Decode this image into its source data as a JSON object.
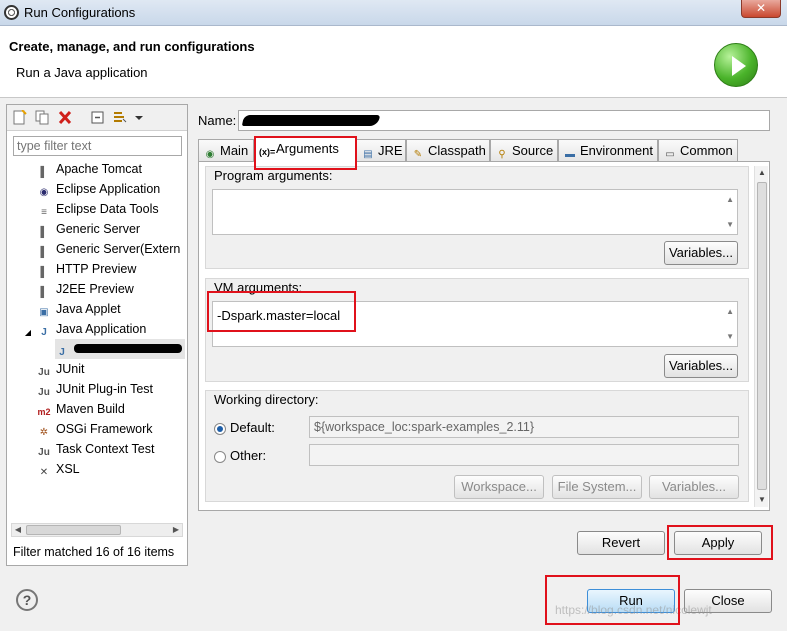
{
  "window": {
    "title": "Run Configurations",
    "close_label": "✕"
  },
  "header": {
    "title": "Create, manage, and run configurations",
    "subtitle": "Run a Java application"
  },
  "left": {
    "filter_placeholder": "type filter text",
    "tree": [
      {
        "label": "Apache Tomcat",
        "icon": "server-icon"
      },
      {
        "label": "Eclipse Application",
        "icon": "eclipse-icon"
      },
      {
        "label": "Eclipse Data Tools",
        "icon": "database-icon"
      },
      {
        "label": "Generic Server",
        "icon": "server-icon"
      },
      {
        "label": "Generic Server(Extern",
        "icon": "server-icon"
      },
      {
        "label": "HTTP Preview",
        "icon": "server-icon"
      },
      {
        "label": "J2EE Preview",
        "icon": "server-icon"
      },
      {
        "label": "Java Applet",
        "icon": "applet-icon"
      },
      {
        "label": "Java Application",
        "icon": "java-app-icon",
        "expanded": true
      },
      {
        "label": "",
        "icon": "java-class-icon",
        "child": true,
        "redacted": true
      },
      {
        "label": "JUnit",
        "icon": "junit-icon"
      },
      {
        "label": "JUnit Plug-in Test",
        "icon": "junit-icon"
      },
      {
        "label": "Maven Build",
        "icon": "maven-icon"
      },
      {
        "label": "OSGi Framework",
        "icon": "osgi-icon"
      },
      {
        "label": "Task Context Test",
        "icon": "junit-icon"
      },
      {
        "label": "XSL",
        "icon": "xsl-icon"
      }
    ],
    "status": "Filter matched 16 of 16 items"
  },
  "right": {
    "name_label": "Name:",
    "tabs": [
      {
        "label": "Main",
        "icon": "main-icon"
      },
      {
        "label": "Arguments",
        "icon": "arguments-icon",
        "active": true
      },
      {
        "label": "JRE",
        "icon": "jre-icon"
      },
      {
        "label": "Classpath",
        "icon": "classpath-icon"
      },
      {
        "label": "Source",
        "icon": "source-icon"
      },
      {
        "label": "Environment",
        "icon": "environment-icon"
      },
      {
        "label": "Common",
        "icon": "common-icon"
      }
    ],
    "program_args": {
      "label": "Program arguments:",
      "value": "",
      "variables_label": "Variables..."
    },
    "vm_args": {
      "label": "VM arguments:",
      "value": "-Dspark.master=local",
      "variables_label": "Variables..."
    },
    "working_dir": {
      "label": "Working directory:",
      "default_label": "Default:",
      "default_value": "${workspace_loc:spark-examples_2.11}",
      "other_label": "Other:",
      "other_value": "",
      "workspace_label": "Workspace...",
      "filesystem_label": "File System...",
      "variables_label": "Variables..."
    },
    "revert_label": "Revert",
    "apply_label": "Apply"
  },
  "footer": {
    "help_label": "?",
    "run_label": "Run",
    "close_label": "Close"
  },
  "watermark": "https://blog.csdn.net/nicolewjt",
  "colors": {
    "highlight": "#e0111b",
    "accent": "#3d8ed8",
    "run_green": "#4ab32a"
  }
}
